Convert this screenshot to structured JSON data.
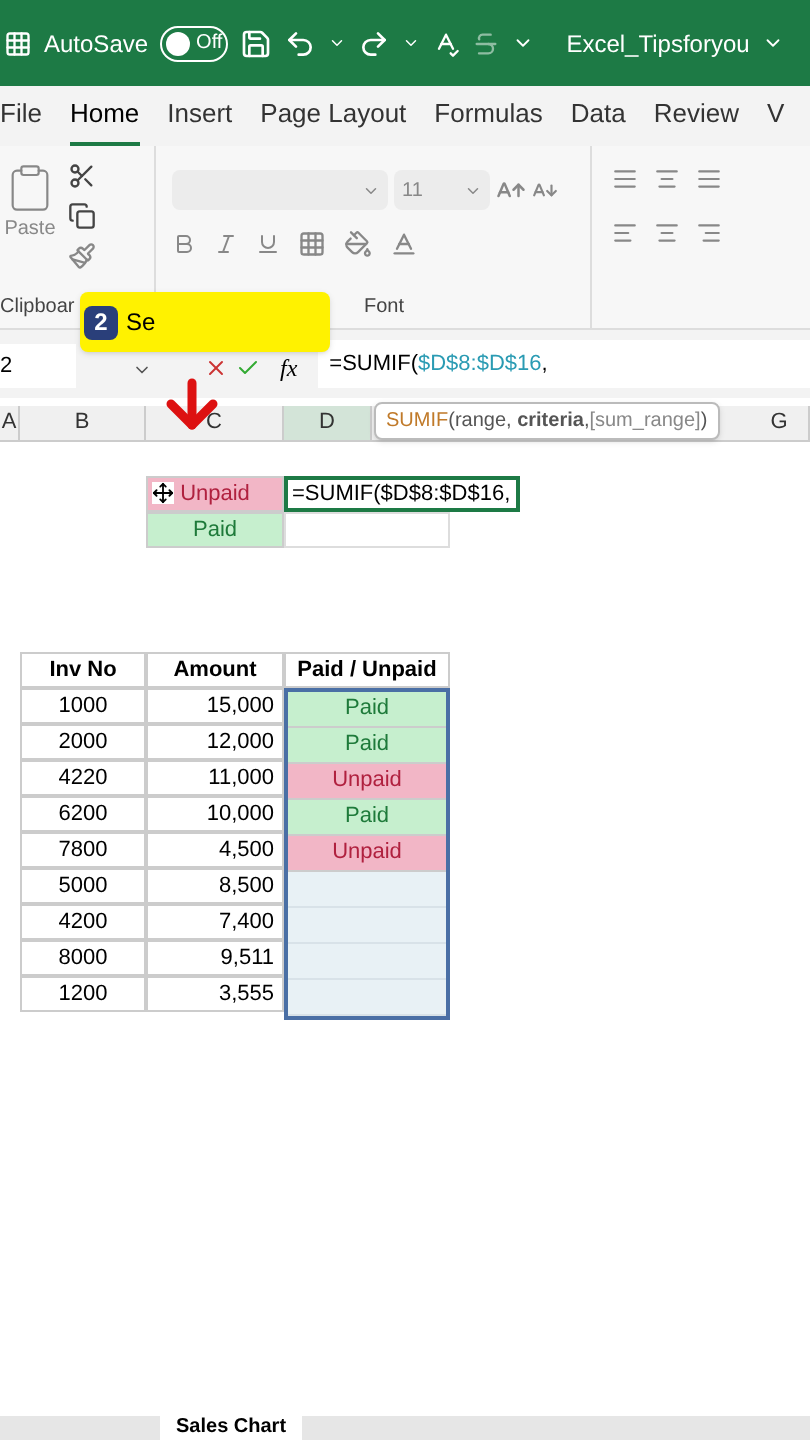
{
  "title_bar": {
    "autosave_label": "AutoSave",
    "autosave": {
      "on": false,
      "label": "Off"
    },
    "file_name": "Excel_Tipsforyou"
  },
  "tabs": [
    {
      "label": "File",
      "selected": false
    },
    {
      "label": "Home",
      "selected": true
    },
    {
      "label": "Insert",
      "selected": false
    },
    {
      "label": "Page Layout",
      "selected": false
    },
    {
      "label": "Formulas",
      "selected": false
    },
    {
      "label": "Data",
      "selected": false
    },
    {
      "label": "Review",
      "selected": false
    },
    {
      "label": "V",
      "selected": false
    }
  ],
  "ribbon": {
    "paste_label": "Paste",
    "font_size": "11",
    "groups": [
      "Clipboar",
      "Font"
    ]
  },
  "callout": {
    "step": "2",
    "text": "Se"
  },
  "formula_bar": {
    "name_box": "2",
    "fx": "fx",
    "formula_prefix": "=SUMIF(",
    "formula_range": "$D$8:$D$16",
    "formula_suffix": ","
  },
  "column_headers": [
    "A",
    "B",
    "C",
    "D",
    "G"
  ],
  "tooltip": {
    "fn": "SUMIF",
    "args": "(range, **criteria**, ",
    "optional": "[sum_range]",
    "close": ")"
  },
  "criteria_cells": [
    {
      "text": "Unpaid",
      "kind": "unpaid"
    },
    {
      "text": "Paid",
      "kind": "paid"
    }
  ],
  "editing_cell": "=SUMIF($D$8:$D$16,",
  "table": {
    "columns": [
      "Inv No",
      "Amount",
      "Paid / Unpaid"
    ],
    "rows": [
      {
        "inv": "1000",
        "amount": "15,000",
        "status": "Paid",
        "kind": "paid"
      },
      {
        "inv": "2000",
        "amount": "12,000",
        "status": "Paid",
        "kind": "paid"
      },
      {
        "inv": "4220",
        "amount": "11,000",
        "status": "Unpaid",
        "kind": "unpaid"
      },
      {
        "inv": "6200",
        "amount": "10,000",
        "status": "Paid",
        "kind": "paid"
      },
      {
        "inv": "7800",
        "amount": "4,500",
        "status": "Unpaid",
        "kind": "unpaid"
      },
      {
        "inv": "5000",
        "amount": "8,500",
        "kind": "blank"
      },
      {
        "inv": "4200",
        "amount": "7,400",
        "kind": "blank"
      },
      {
        "inv": "8000",
        "amount": "9,511",
        "kind": "blank"
      },
      {
        "inv": "1200",
        "amount": "3,555",
        "kind": "blank"
      }
    ]
  },
  "sheet_tabs": [
    {
      "label": "Sales Chart",
      "selected": true
    }
  ]
}
